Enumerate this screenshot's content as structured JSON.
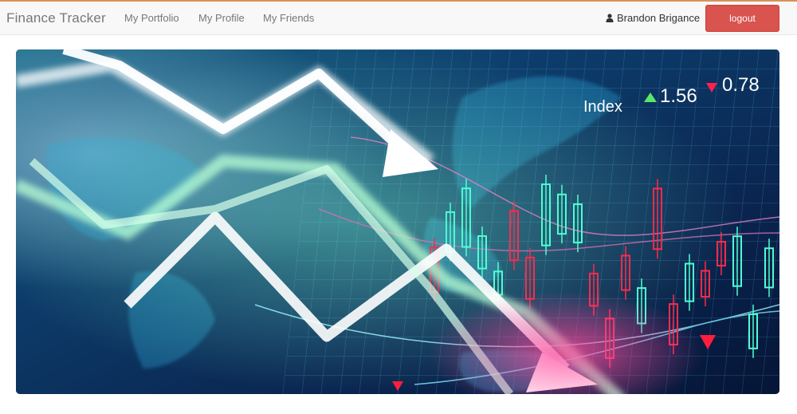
{
  "navbar": {
    "brand": "Finance Tracker",
    "links": [
      "My Portfolio",
      "My Profile",
      "My Friends"
    ],
    "user_name": "Brandon Brigance",
    "logout_label": "logout",
    "logout_color": "#d9534f"
  },
  "hero": {
    "index_label": "Index",
    "index_up_value": "1.56",
    "index_down_value": "0.78"
  }
}
